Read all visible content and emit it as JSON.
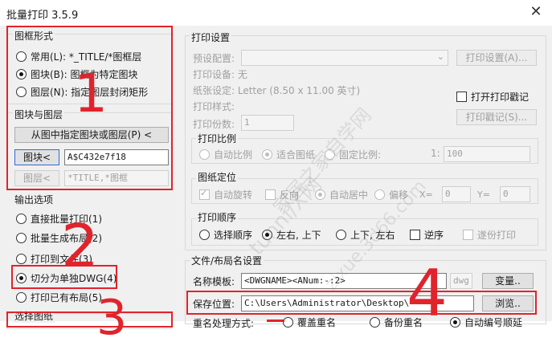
{
  "window": {
    "title": "批量打印 3.5.9",
    "close_glyph": "✕"
  },
  "frame_style": {
    "label": "图框形式",
    "options": [
      {
        "label": "常用(L): *_TITLE/*图框层",
        "selected": false
      },
      {
        "label": "图块(B): 图框为特定图块",
        "selected": true
      },
      {
        "label": "图层(N): 指定图层封闭矩形",
        "selected": false
      }
    ]
  },
  "block_layer": {
    "label": "图块与图层",
    "pick_button": "从图中指定图块或图层(P) <",
    "block_button": "图块<",
    "block_value": "A$C432e7f18",
    "layer_button": "图层<",
    "layer_value": "*TITLE,*图框"
  },
  "output": {
    "label": "输出选项",
    "options": [
      {
        "label": "直接批量打印(1)",
        "selected": false
      },
      {
        "label": "批量生成布局(2)",
        "selected": false
      },
      {
        "label": "打印到文件(3)",
        "selected": false
      },
      {
        "label": "切分为单独DWG(4)",
        "selected": true
      },
      {
        "label": "打印已有布局(5)",
        "selected": false
      }
    ]
  },
  "select_drawing": {
    "label": "选择图纸"
  },
  "print_settings": {
    "label": "打印设置",
    "preset_label": "预设配置:",
    "settings_button": "打印设置(A)...",
    "device_label": "打印设备: 无",
    "paper_label": "纸张设定: Letter (8.50 x 11.00 英寸)",
    "style_label": "打印样式:",
    "open_stamp_label": "打开打印戳记",
    "copies_label": "打印份数:",
    "copies_value": "1",
    "stamp_button": "打印戳记(S)..."
  },
  "scale": {
    "label": "打印比例",
    "options": [
      {
        "label": "自动比例",
        "selected": false
      },
      {
        "label": "适合图纸",
        "selected": true
      },
      {
        "label": "固定比例:",
        "selected": false
      }
    ],
    "ratio_prefix": "1:",
    "ratio_value": "100"
  },
  "position": {
    "label": "图纸定位",
    "auto_rotate": "自动旋转",
    "auto_rotate_checked": true,
    "reverse": "反向",
    "auto_center": "自动居中",
    "offset": "偏移",
    "x_label": "X=",
    "x_value": "0",
    "y_label": "Y=",
    "y_value": "0"
  },
  "order": {
    "label": "打印顺序",
    "options": [
      {
        "label": "选择顺序",
        "selected": false
      },
      {
        "label": "左右, 上下",
        "selected": true
      },
      {
        "label": "上下, 左右",
        "selected": false
      }
    ],
    "reverse_label": "逆序",
    "recursive_label": "遂份打印"
  },
  "naming": {
    "label": "文件/布局名设置",
    "name_template_label": "名称模板:",
    "name_template_value": "<DWGNAME><ANum:-:2>",
    "ext_value": "dwg",
    "variables_button": "变量..",
    "save_label": "保存位置:",
    "save_value": "C:\\Users\\Administrator\\Desktop\\",
    "browse_button": "浏览..",
    "dup_label": "重名处理方式:",
    "dup_options": [
      "覆盖重名",
      "备份重名",
      "自动编号顺延"
    ]
  },
  "annotations": {
    "numbers": [
      "1",
      "2",
      "3",
      "4"
    ],
    "watermark_1": "tunni/X网",
    "watermark_2": "家居之家自学网",
    "watermark_3": "zixue.3d66.com"
  },
  "colors": {
    "annotation_red": "#e0242c",
    "focus_blue": "#2e6bd6",
    "dialog_bg": "#f0f0f0"
  }
}
